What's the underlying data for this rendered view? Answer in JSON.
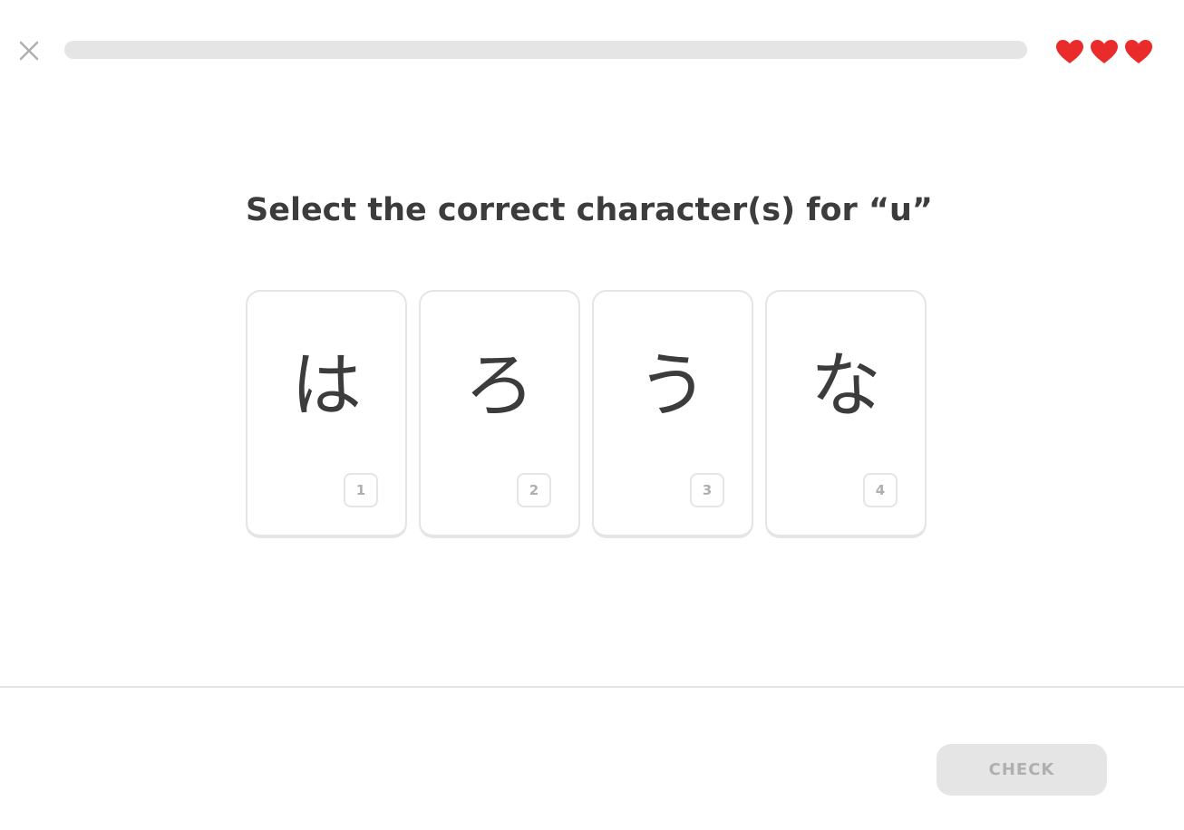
{
  "header": {
    "close_icon": "close-icon",
    "progress_fraction": 0,
    "hearts_count": 3,
    "heart_icon": "heart-icon",
    "heart_color": "#ea2b2b"
  },
  "exercise": {
    "prompt": "Select the correct character(s) for “u”",
    "choices": [
      {
        "character": "は",
        "key": "1"
      },
      {
        "character": "ろ",
        "key": "2"
      },
      {
        "character": "う",
        "key": "3"
      },
      {
        "character": "な",
        "key": "4"
      }
    ]
  },
  "footer": {
    "check_label": "CHECK",
    "check_enabled": false
  }
}
